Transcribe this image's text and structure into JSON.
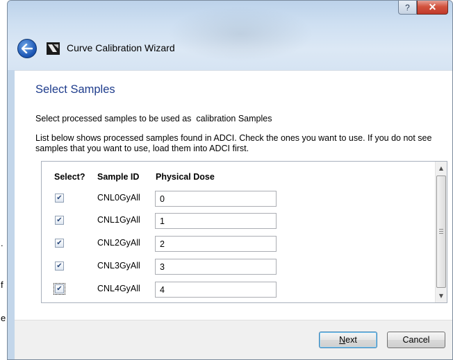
{
  "window": {
    "title": "Curve Calibration Wizard",
    "caption": {
      "help": "?",
      "close": "✕"
    }
  },
  "page": {
    "heading": "Select Samples",
    "description1": "Select processed samples to be used as  calibration Samples",
    "description2": "List below shows processed samples found in ADCI. Check the ones you want to use. If you do not see samples that you want to use, load them into ADCI first."
  },
  "table": {
    "headers": [
      "Select?",
      "Sample ID",
      "Physical Dose"
    ],
    "rows": [
      {
        "selected": true,
        "sample_id": "CNL0GyAll",
        "dose": "0"
      },
      {
        "selected": true,
        "sample_id": "CNL1GyAll",
        "dose": "1"
      },
      {
        "selected": true,
        "sample_id": "CNL2GyAll",
        "dose": "2"
      },
      {
        "selected": true,
        "sample_id": "CNL3GyAll",
        "dose": "3"
      },
      {
        "selected": true,
        "sample_id": "CNL4GyAll",
        "dose": "4"
      }
    ]
  },
  "buttons": {
    "next": "Next",
    "cancel": "Cancel"
  },
  "icons": {
    "back": "back-arrow-icon",
    "app": "wizard-app-icon",
    "check": "checkmark-icon"
  },
  "colors": {
    "heading": "#1e3c8c",
    "back_button": "#1d57b5",
    "close_button": "#c0392b"
  }
}
